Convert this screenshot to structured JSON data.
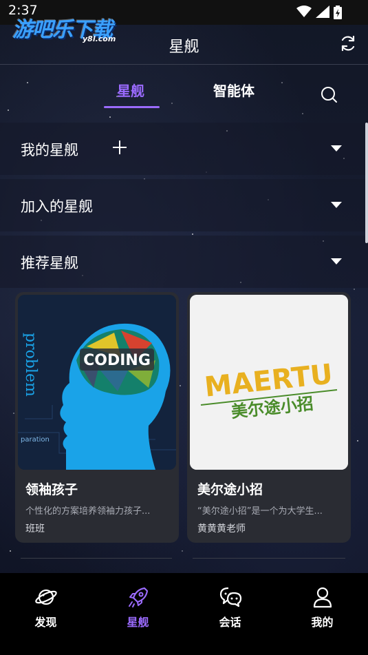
{
  "status_bar": {
    "time": "2:37"
  },
  "watermark": {
    "main": "游吧乐下载",
    "sub": "y8l.com"
  },
  "header": {
    "title": "星舰",
    "refresh_icon": "refresh-icon"
  },
  "tabs": [
    {
      "label": "星舰",
      "active": true
    },
    {
      "label": "智能体",
      "active": false
    }
  ],
  "sections": [
    {
      "label": "我的星舰",
      "has_add": true
    },
    {
      "label": "加入的星舰",
      "has_add": false
    },
    {
      "label": "推荐星舰",
      "has_add": false
    }
  ],
  "cards": [
    {
      "title": "领袖孩子",
      "description": "个性化的方案培养领袖力孩子...",
      "author": "班班",
      "image": {
        "coding_text": "CODING",
        "side_text": "problem",
        "bottom_text": "paration"
      }
    },
    {
      "title": "美尔途小招",
      "description": "“美尔途小招”是一个为大学生...",
      "author": "黄黄黄老师",
      "image": {
        "logo_en": "MAERTU",
        "logo_cn": "美尔途小招"
      }
    }
  ],
  "bottom_nav": [
    {
      "label": "发现",
      "icon": "planet-icon",
      "active": false
    },
    {
      "label": "星舰",
      "icon": "rocket-icon",
      "active": true
    },
    {
      "label": "会话",
      "icon": "chat-icon",
      "active": false
    },
    {
      "label": "我的",
      "icon": "user-icon",
      "active": false
    }
  ],
  "colors": {
    "accent": "#9b6bff",
    "background": "#121726",
    "card": "#2a2c33",
    "nav": "#000000"
  }
}
